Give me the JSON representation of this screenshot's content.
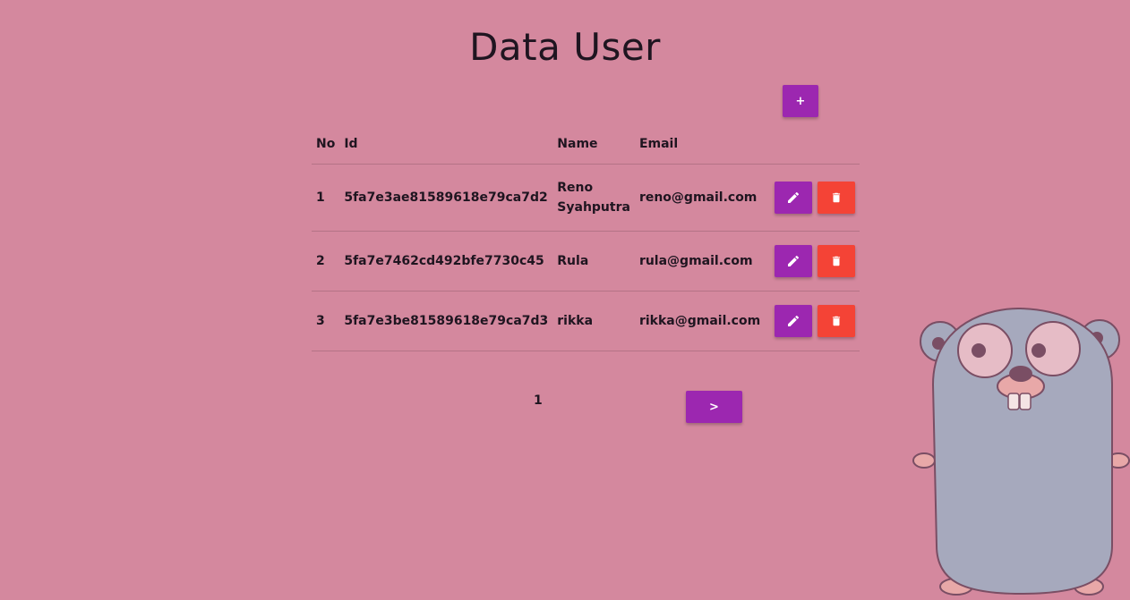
{
  "header": {
    "title": "Data User"
  },
  "toolbar": {
    "add_label": "+"
  },
  "table": {
    "columns": [
      "No",
      "Id",
      "Name",
      "Email"
    ],
    "rows": [
      {
        "no": "1",
        "id": "5fa7e3ae81589618e79ca7d2",
        "name": "Reno Syahputra",
        "email": "reno@gmail.com"
      },
      {
        "no": "2",
        "id": "5fa7e7462cd492bfe7730c45",
        "name": "Rula",
        "email": "rula@gmail.com"
      },
      {
        "no": "3",
        "id": "5fa7e3be81589618e79ca7d3",
        "name": "rikka",
        "email": "rikka@gmail.com"
      }
    ],
    "row_actions": {
      "edit_icon": "pencil-icon",
      "delete_icon": "trash-icon"
    }
  },
  "pagination": {
    "current_page": "1",
    "next_label": ">"
  },
  "colors": {
    "background": "#d4889e",
    "primary": "#9c27b0",
    "danger": "#f44336"
  },
  "decoration": {
    "mascot": "gopher-mascot"
  }
}
